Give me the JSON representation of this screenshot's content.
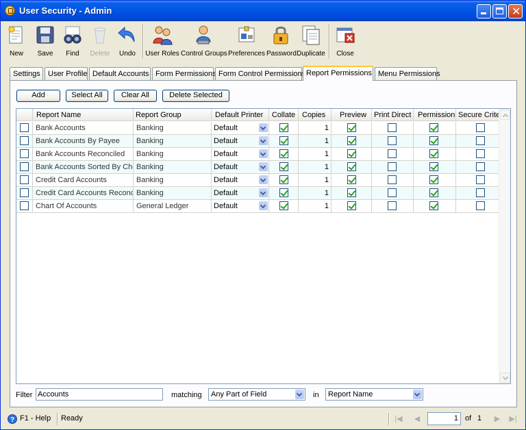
{
  "window": {
    "title": "User Security - Admin"
  },
  "toolbar": {
    "new": "New",
    "save": "Save",
    "find": "Find",
    "delete": "Delete",
    "undo": "Undo",
    "user_roles": "User Roles",
    "control_groups": "Control Groups",
    "preferences": "Preferences",
    "password": "Password",
    "duplicate": "Duplicate",
    "close": "Close"
  },
  "tabs": [
    "Settings",
    "User Profile",
    "Default Accounts",
    "Form Permissions",
    "Form Control Permissions",
    "Report Permissions",
    "Menu Permissions"
  ],
  "active_tab": "Report Permissions",
  "actions": {
    "add": "Add",
    "select_all": "Select All",
    "clear_all": "Clear All",
    "delete_selected": "Delete Selected"
  },
  "grid": {
    "columns": [
      "Report Name",
      "Report Group",
      "Default Printer",
      "Collate",
      "Copies",
      "Preview",
      "Print Direct",
      "Permission",
      "Secure Criteri"
    ],
    "rows": [
      {
        "name": "Bank Accounts",
        "group": "Banking",
        "printer": "Default",
        "collate": true,
        "copies": "1",
        "preview": true,
        "print_direct": false,
        "permission": true,
        "secure": false
      },
      {
        "name": "Bank Accounts By Payee",
        "group": "Banking",
        "printer": "Default",
        "collate": true,
        "copies": "1",
        "preview": true,
        "print_direct": false,
        "permission": true,
        "secure": false
      },
      {
        "name": "Bank Accounts Reconciled",
        "group": "Banking",
        "printer": "Default",
        "collate": true,
        "copies": "1",
        "preview": true,
        "print_direct": false,
        "permission": true,
        "secure": false
      },
      {
        "name": "Bank Accounts Sorted By Che",
        "group": "Banking",
        "printer": "Default",
        "collate": true,
        "copies": "1",
        "preview": true,
        "print_direct": false,
        "permission": true,
        "secure": false
      },
      {
        "name": "Credit Card Accounts",
        "group": "Banking",
        "printer": "Default",
        "collate": true,
        "copies": "1",
        "preview": true,
        "print_direct": false,
        "permission": true,
        "secure": false
      },
      {
        "name": "Credit Card Accounts Reconci",
        "group": "Banking",
        "printer": "Default",
        "collate": true,
        "copies": "1",
        "preview": true,
        "print_direct": false,
        "permission": true,
        "secure": false
      },
      {
        "name": "Chart Of Accounts",
        "group": "General Ledger",
        "printer": "Default",
        "collate": true,
        "copies": "1",
        "preview": true,
        "print_direct": false,
        "permission": true,
        "secure": false
      }
    ]
  },
  "filter": {
    "label": "Filter",
    "value": "Accounts",
    "matching_label": "matching",
    "matching_value": "Any Part of Field",
    "in_label": "in",
    "in_value": "Report Name"
  },
  "status": {
    "help": "F1 - Help",
    "state": "Ready",
    "page": "1",
    "of_label": "of",
    "total": "1"
  },
  "colors": {
    "title_bar": "#0055E5",
    "active_tab_accent": "#FFC73C",
    "row_alt": "#F0FBFB",
    "check": "#21A121"
  }
}
